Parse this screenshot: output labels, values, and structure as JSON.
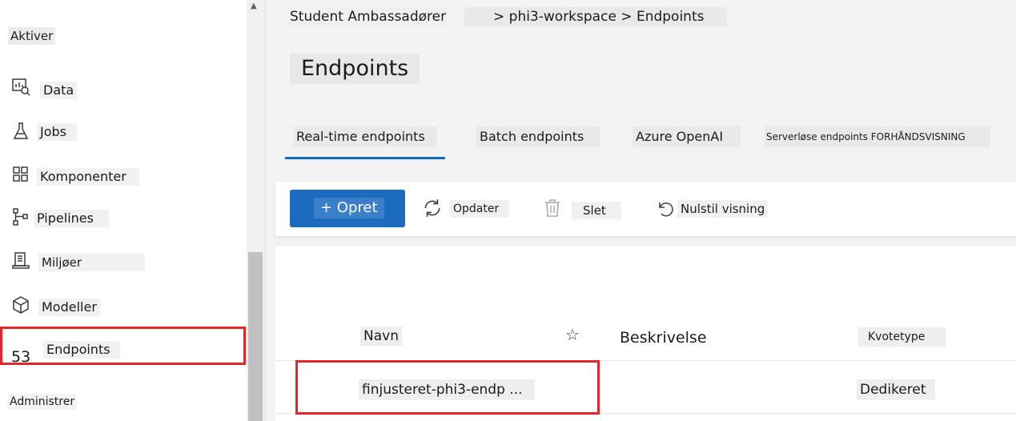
{
  "sidebar": {
    "section_activate": "Aktiver",
    "items": [
      {
        "label": "Data",
        "icon": "data-icon"
      },
      {
        "label": "Jobs",
        "icon": "flask-icon"
      },
      {
        "label": "Komponenter",
        "icon": "components-icon"
      },
      {
        "label": "Pipelines",
        "icon": "pipeline-icon"
      },
      {
        "label": "Miljøer",
        "icon": "environment-icon"
      },
      {
        "label": "Modeller",
        "icon": "cube-icon"
      },
      {
        "label": "Endpoints",
        "icon": "endpoint-icon"
      }
    ],
    "endpoints_count": "53",
    "section_manage": "Administrer"
  },
  "header": {
    "breadcrumb_root": "Student Ambassadører",
    "breadcrumb_path": "> phi3-workspace > Endpoints",
    "title": "Endpoints"
  },
  "tabs": [
    {
      "label": "Real-time endpoints",
      "active": true
    },
    {
      "label": "Batch endpoints",
      "active": false
    },
    {
      "label": "Azure OpenAI",
      "active": false
    },
    {
      "label": "Serverløse endpoints FORHÅNDSVISNING",
      "active": false
    }
  ],
  "toolbar": {
    "create_label": "+ Opret",
    "refresh_label": "Opdater",
    "delete_label": "Slet",
    "reset_label": "Nulstil visning"
  },
  "table": {
    "columns": [
      "Navn",
      "Beskrivelse",
      "Kvotetype"
    ],
    "rows": [
      {
        "name": "finjusteret-phi3-endp ...",
        "description": "",
        "quota_type": "Dedikeret"
      }
    ]
  },
  "colors": {
    "accent": "#0f6cbd",
    "primary_button": "#1c6bbf",
    "highlight_box": "#e0282e"
  }
}
